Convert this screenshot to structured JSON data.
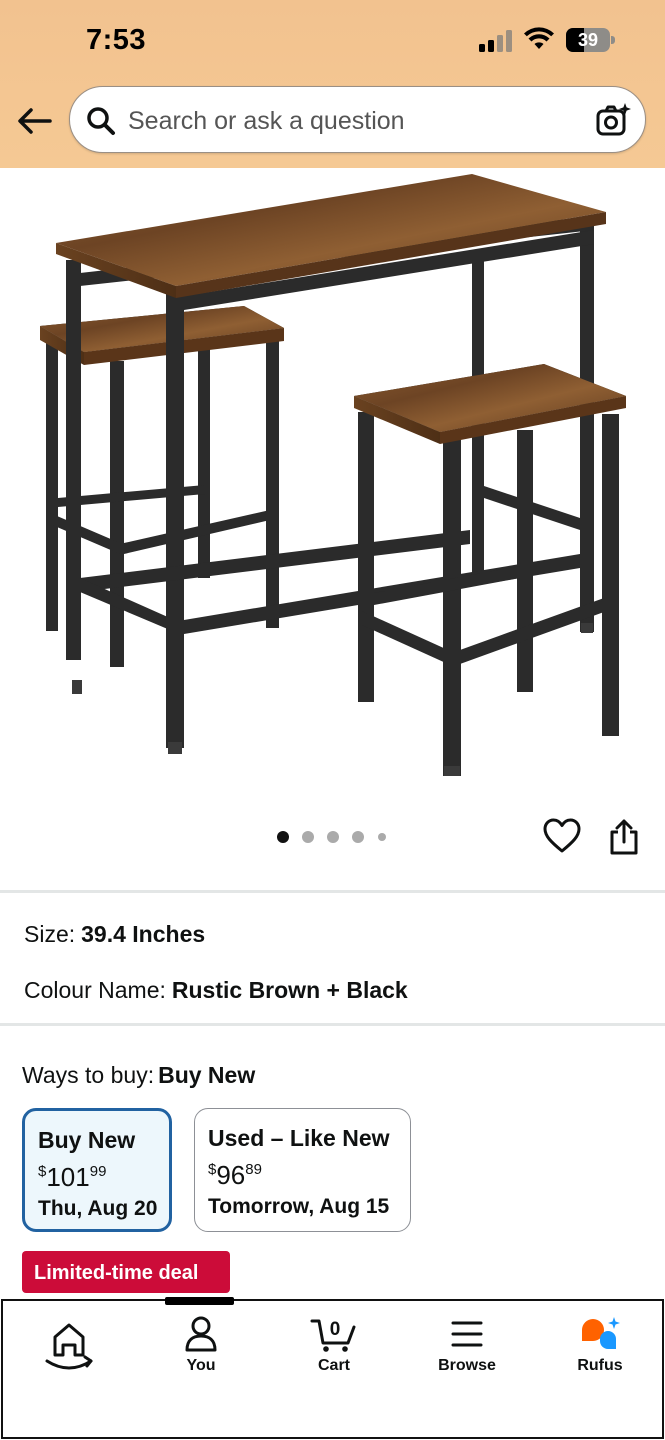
{
  "status_bar": {
    "time": "7:53",
    "battery_level": "39",
    "icons": [
      "signal-icon",
      "wifi-icon",
      "battery-icon"
    ]
  },
  "header": {
    "search_placeholder": "Search or ask a question",
    "icons": [
      "back-arrow-icon",
      "search-icon",
      "camera-search-icon"
    ],
    "background_color": "#f5c994"
  },
  "gallery": {
    "image_count": 5,
    "active_index": 0,
    "icons": [
      "heart-icon",
      "share-icon"
    ]
  },
  "attributes": [
    {
      "label": "Size:",
      "value": "39.4 Inches"
    },
    {
      "label": "Colour Name:",
      "value": "Rustic Brown + Black"
    }
  ],
  "ways_to_buy": {
    "label": "Ways to buy:",
    "selected": "Buy New",
    "options": [
      {
        "title": "Buy New",
        "currency": "$",
        "dollars": "101",
        "cents": "99",
        "delivery": "Thu, Aug 20"
      },
      {
        "title": "Used – Like New",
        "currency": "$",
        "dollars": "96",
        "cents": "89",
        "delivery": "Tomorrow, Aug 15"
      }
    ],
    "selected_border_color": "#2162a1"
  },
  "deal_badge": {
    "label": "Limited-time deal",
    "color": "#cc0c39"
  },
  "bottom_nav": {
    "items": [
      {
        "label": "",
        "icon": "home-icon"
      },
      {
        "label": "You",
        "icon": "user-icon"
      },
      {
        "label": "Cart",
        "icon": "cart-icon",
        "count": "0"
      },
      {
        "label": "Browse",
        "icon": "menu-icon"
      },
      {
        "label": "Rufus",
        "icon": "rufus-icon"
      }
    ],
    "rufus_colors": [
      "#ff6200",
      "#1a98ff"
    ]
  }
}
